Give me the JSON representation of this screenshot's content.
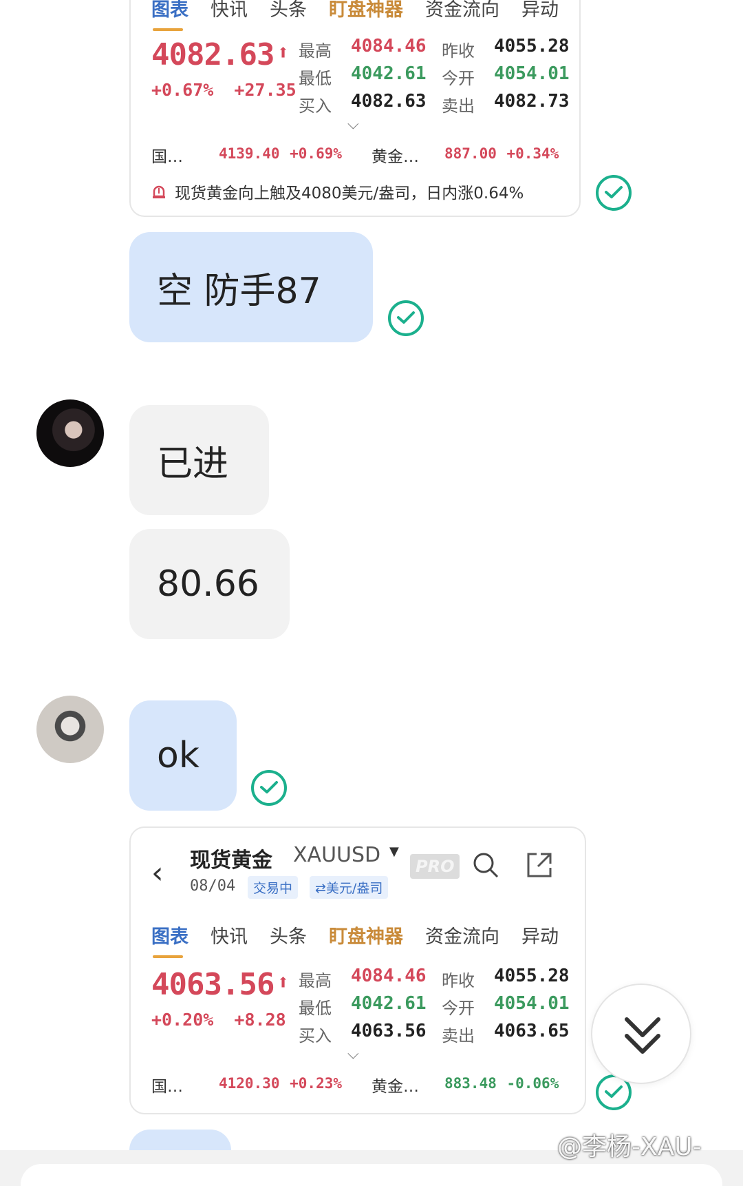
{
  "card1": {
    "tabs": [
      "图表",
      "快讯",
      "头条",
      "盯盘神器",
      "资金流向",
      "异动"
    ],
    "price": "4082.63",
    "change_pct": "+0.67%",
    "change_abs": "+27.35",
    "grid": {
      "high_label": "最高",
      "high": "4084.46",
      "prev_label": "昨收",
      "prev": "4055.28",
      "low_label": "最低",
      "low": "4042.61",
      "open_label": "今开",
      "open": "4054.01",
      "buy_label": "买入",
      "buy": "4082.63",
      "sell_label": "卖出",
      "sell": "4082.73"
    },
    "idx1_name": "国…",
    "idx1_val": "4139.40",
    "idx1_pct": "+0.69%",
    "idx2_name": "黄金…",
    "idx2_val": "887.00",
    "idx2_pct": "+0.34%",
    "alert": "现货黄金向上触及4080美元/盎司，日内涨0.64%"
  },
  "msg1": "空  防手87",
  "msg2": "已进",
  "msg3": "80.66",
  "msg4": "ok",
  "card2": {
    "title": "现货黄金",
    "symbol": "XAUUSD",
    "pro": "PRO",
    "date": "08/04",
    "status": "交易中",
    "unit": "⇄美元/盎司",
    "tabs": [
      "图表",
      "快讯",
      "头条",
      "盯盘神器",
      "资金流向",
      "异动"
    ],
    "price": "4063.56",
    "change_pct": "+0.20%",
    "change_abs": "+8.28",
    "grid": {
      "high_label": "最高",
      "high": "4084.46",
      "prev_label": "昨收",
      "prev": "4055.28",
      "low_label": "最低",
      "low": "4042.61",
      "open_label": "今开",
      "open": "4054.01",
      "buy_label": "买入",
      "buy": "4063.56",
      "sell_label": "卖出",
      "sell": "4063.65"
    },
    "idx1_name": "国…",
    "idx1_val": "4120.30",
    "idx1_pct": "+0.23%",
    "idx2_name": "黄金…",
    "idx2_val": "883.48",
    "idx2_pct": "-0.06%"
  },
  "watermark": "@李杨-XAU-",
  "colors": {
    "up": "#d4485a",
    "down": "#3b9a5e",
    "accent": "#3a6fc4",
    "check": "#1bb08d",
    "bubble_me": "#d7e6fb"
  }
}
